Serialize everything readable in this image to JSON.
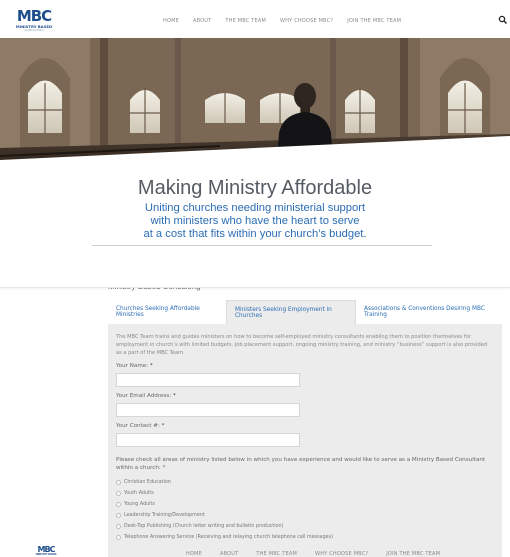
{
  "logo": {
    "mark": "MBC",
    "line1": "MINISTRY BASED",
    "line2": "CONSULTING"
  },
  "nav": {
    "items": [
      "HOME",
      "ABOUT",
      "THE MBC TEAM",
      "WHY CHOOSE MBC?",
      "JOIN THE MBC TEAM"
    ]
  },
  "hero": {
    "title": "Making Ministry Affordable",
    "subtitle_lines": [
      "Uniting churches needing ministerial support",
      "with ministers who have the heart to serve",
      "at a cost that fits within your church’s budget."
    ]
  },
  "section_heading": "Ministry Based Consulting",
  "tabs": [
    {
      "label": "Churches Seeking Affordable Ministries"
    },
    {
      "label": "Ministers Seeking Employment in Churches"
    },
    {
      "label": "Associations & Conventions Desiring MBC Training"
    }
  ],
  "panel": {
    "description": "The MBC Team trains and guides ministers on how to become self-employed ministry consultants enabling them to position themselves for employment in church’s with limited budgets. Job placement support, ongoing ministry training, and ministry “business” support is also provided as a part of the MBC Team.",
    "fields": [
      {
        "label": "Your Name:",
        "required": "*",
        "value": ""
      },
      {
        "label": "Your Email Address:",
        "required": "*",
        "value": ""
      },
      {
        "label": "Your Contact #:",
        "required": "*",
        "value": ""
      }
    ],
    "question": "Please check all areas of ministry listed below in which you have experience and would like to serve as a Ministry Based Consultant within a church:",
    "question_required": "*",
    "options": [
      "Christian Education",
      "Youth Adults",
      "Young Adults",
      "Leadership Training/Development",
      "Desk-Top Publishing (Church letter writing and bulletin production)",
      "Telephone Answering Service (Receiving and relaying church telephone call messages)"
    ]
  }
}
